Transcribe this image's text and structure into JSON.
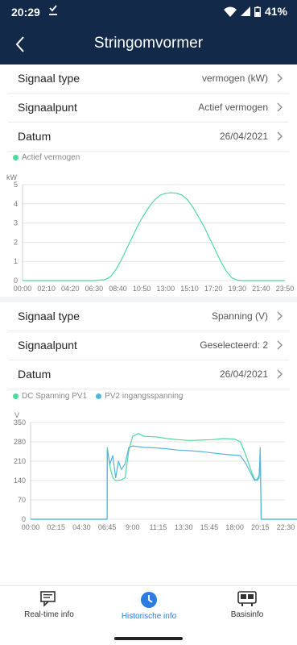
{
  "status_bar": {
    "time": "20:29",
    "battery": "41%"
  },
  "header": {
    "title": "Stringomvormer"
  },
  "section1": {
    "signal_type": {
      "label": "Signaal type",
      "value": "vermogen (kW)"
    },
    "signal_point": {
      "label": "Signaalpunt",
      "value": "Actief vermogen"
    },
    "date": {
      "label": "Datum",
      "value": "26/04/2021"
    }
  },
  "section2": {
    "signal_type": {
      "label": "Signaal type",
      "value": "Spanning (V)"
    },
    "signal_point": {
      "label": "Signaalpunt",
      "value": "Geselecteerd: 2"
    },
    "date": {
      "label": "Datum",
      "value": "26/04/2021"
    }
  },
  "colors": {
    "header_bg": "#12294a",
    "series_green": "#4fd8a0",
    "series_blue": "#55b4e0",
    "nav_active": "#2b7de0"
  },
  "nav": [
    {
      "label": "Real-time info",
      "icon": "chat-icon",
      "active": false
    },
    {
      "label": "Historische info",
      "icon": "clock-icon",
      "active": true
    },
    {
      "label": "Basisinfo",
      "icon": "device-icon",
      "active": false
    }
  ],
  "chart_data": [
    {
      "type": "line",
      "ylabel": "kW",
      "ylim": [
        0,
        5
      ],
      "yticks": [
        "0",
        "1",
        "2",
        "3",
        "4",
        "5"
      ],
      "xticks": [
        "00:00",
        "02:10",
        "04:20",
        "06:30",
        "08:40",
        "10:50",
        "13:00",
        "15:10",
        "17:20",
        "19:30",
        "21:40",
        "23:50"
      ],
      "grid": true,
      "legend": "top-left",
      "series": [
        {
          "name": "Actief vermogen",
          "color": "#4fd8a0",
          "points": [
            [
              "00:00",
              0
            ],
            [
              "06:30",
              0
            ],
            [
              "07:30",
              0.05
            ],
            [
              "08:00",
              0.2
            ],
            [
              "08:30",
              0.6
            ],
            [
              "09:00",
              1.1
            ],
            [
              "09:30",
              1.7
            ],
            [
              "10:00",
              2.3
            ],
            [
              "10:30",
              2.9
            ],
            [
              "11:00",
              3.4
            ],
            [
              "11:30",
              3.85
            ],
            [
              "12:00",
              4.2
            ],
            [
              "12:30",
              4.45
            ],
            [
              "13:00",
              4.55
            ],
            [
              "13:30",
              4.58
            ],
            [
              "14:00",
              4.55
            ],
            [
              "14:30",
              4.45
            ],
            [
              "15:00",
              4.2
            ],
            [
              "15:30",
              3.8
            ],
            [
              "16:00",
              3.3
            ],
            [
              "16:30",
              2.8
            ],
            [
              "17:00",
              2.2
            ],
            [
              "17:30",
              1.6
            ],
            [
              "18:00",
              1.0
            ],
            [
              "18:30",
              0.5
            ],
            [
              "19:00",
              0.15
            ],
            [
              "19:30",
              0.02
            ],
            [
              "20:00",
              0
            ],
            [
              "23:50",
              0
            ]
          ]
        }
      ]
    },
    {
      "type": "line",
      "ylabel": "V",
      "ylim": [
        0,
        350
      ],
      "yticks": [
        "0",
        "70",
        "140",
        "210",
        "280",
        "350"
      ],
      "xticks": [
        "00:00",
        "02:15",
        "04:30",
        "06:45",
        "9:00",
        "11:15",
        "13:30",
        "15:45",
        "18:00",
        "20:15",
        "22:30"
      ],
      "grid": true,
      "legend": "top-left",
      "series": [
        {
          "name": "DC Spanning PV1",
          "color": "#4fd8a0",
          "points": [
            [
              "00:00",
              0
            ],
            [
              "06:45",
              0
            ],
            [
              "06:46",
              260
            ],
            [
              "07:00",
              190
            ],
            [
              "07:15",
              150
            ],
            [
              "07:30",
              140
            ],
            [
              "08:00",
              142
            ],
            [
              "08:20",
              150
            ],
            [
              "08:40",
              250
            ],
            [
              "09:00",
              300
            ],
            [
              "09:30",
              310
            ],
            [
              "10:00",
              300
            ],
            [
              "11:00",
              298
            ],
            [
              "12:00",
              292
            ],
            [
              "13:00",
              288
            ],
            [
              "14:00",
              285
            ],
            [
              "15:00",
              286
            ],
            [
              "16:00",
              288
            ],
            [
              "17:00",
              292
            ],
            [
              "18:00",
              290
            ],
            [
              "18:30",
              280
            ],
            [
              "19:00",
              230
            ],
            [
              "19:30",
              170
            ],
            [
              "19:45",
              145
            ],
            [
              "20:00",
              140
            ],
            [
              "20:10",
              150
            ],
            [
              "20:15",
              260
            ],
            [
              "20:20",
              0
            ],
            [
              "23:50",
              0
            ]
          ]
        },
        {
          "name": "PV2 ingangsspanning",
          "color": "#55b4e0",
          "points": [
            [
              "00:00",
              0
            ],
            [
              "06:45",
              0
            ],
            [
              "06:46",
              250
            ],
            [
              "07:00",
              200
            ],
            [
              "07:15",
              230
            ],
            [
              "07:30",
              150
            ],
            [
              "07:45",
              210
            ],
            [
              "08:00",
              180
            ],
            [
              "08:20",
              200
            ],
            [
              "08:40",
              260
            ],
            [
              "09:00",
              265
            ],
            [
              "10:00",
              260
            ],
            [
              "11:00",
              258
            ],
            [
              "12:00",
              255
            ],
            [
              "13:00",
              250
            ],
            [
              "14:00",
              248
            ],
            [
              "15:00",
              245
            ],
            [
              "16:00",
              240
            ],
            [
              "17:00",
              235
            ],
            [
              "18:00",
              232
            ],
            [
              "18:30",
              230
            ],
            [
              "19:00",
              200
            ],
            [
              "19:30",
              160
            ],
            [
              "19:45",
              140
            ],
            [
              "20:00",
              145
            ],
            [
              "20:10",
              160
            ],
            [
              "20:15",
              250
            ],
            [
              "20:20",
              0
            ],
            [
              "23:50",
              0
            ]
          ]
        }
      ]
    }
  ]
}
